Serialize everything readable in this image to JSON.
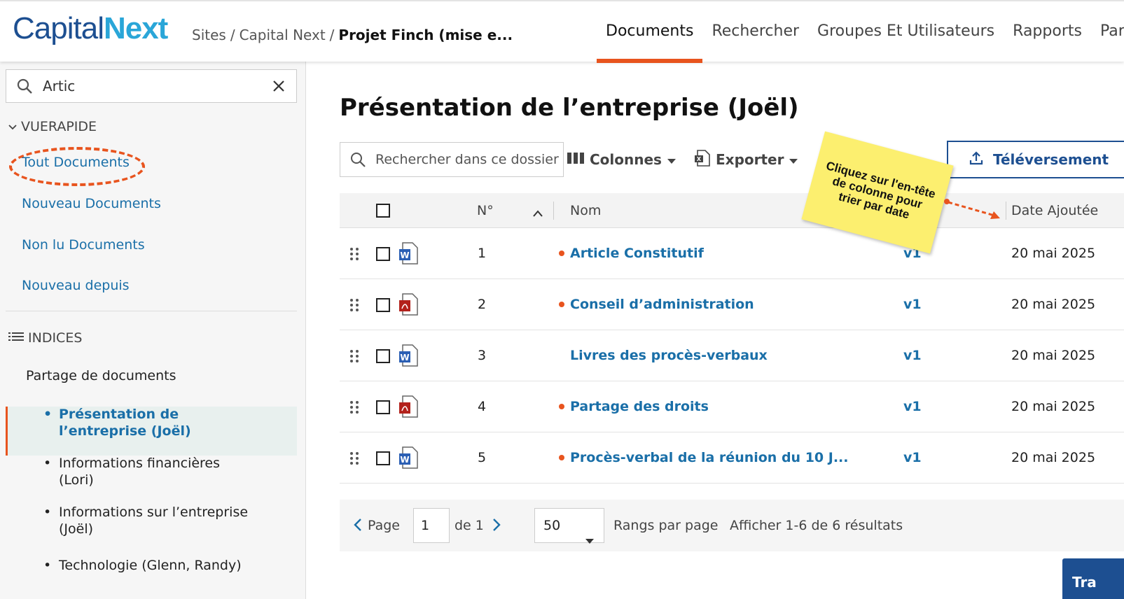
{
  "brand": {
    "part1": "Capital",
    "part2": "Next"
  },
  "breadcrumb": {
    "sites": "Sites",
    "sep": "/",
    "site": "Capital Next",
    "current": "Projet Finch (mise e..."
  },
  "topnav": [
    "Documents",
    "Rechercher",
    "Groupes Et Utilisateurs",
    "Rapports",
    "Para"
  ],
  "sidebar": {
    "search_value": "Artic",
    "quick_view_title": "VUERAPIDE",
    "quick_links": [
      "Tout Documents",
      "Nouveau Documents",
      "Non lu Documents",
      "Nouveau depuis"
    ],
    "indices_title": "INDICES",
    "index_root": "Partage de documents",
    "index_items": [
      {
        "line1": "Présentation de",
        "line2": "l’entreprise (Joël)"
      },
      {
        "line1": "Informations financières",
        "line2": "(Lori)"
      },
      {
        "line1": "Informations sur l’entreprise",
        "line2": "(Joël)"
      },
      {
        "line1": "Technologie (Glenn, Randy)",
        "line2": ""
      }
    ]
  },
  "main": {
    "title": "Présentation de l’entreprise (Joël)",
    "folder_search_placeholder": "Rechercher dans ce dossier",
    "columns_label": "Colonnes",
    "export_label": "Exporter",
    "upload_label": "Téléversement",
    "headers": {
      "num": "N°",
      "name": "Nom",
      "date": "Date Ajoutée"
    },
    "rows": [
      {
        "num": "1",
        "name": "Article Constitutif",
        "version": "v1",
        "date": "20 mai 2025",
        "type": "word",
        "new": true
      },
      {
        "num": "2",
        "name": "Conseil d’administration",
        "version": "v1",
        "date": "20 mai 2025",
        "type": "pdf",
        "new": true
      },
      {
        "num": "3",
        "name": "Livres des procès-verbaux",
        "version": "v1",
        "date": "20 mai 2025",
        "type": "word",
        "new": false
      },
      {
        "num": "4",
        "name": "Partage des droits",
        "version": "v1",
        "date": "20 mai 2025",
        "type": "pdf",
        "new": true
      },
      {
        "num": "5",
        "name": "Procès-verbal de la réunion du 10 J...",
        "version": "v1",
        "date": "20 mai 2025",
        "type": "word",
        "new": true
      }
    ],
    "pager": {
      "page_label": "Page",
      "page_value": "1",
      "of_label": "de 1",
      "per_page": "50",
      "per_page_label": "Rangs par page",
      "results": "Afficher 1-6 de 6 résultats"
    },
    "bottom_button": "Tra"
  },
  "annotation": {
    "note": "Cliquez sur l'en-tête de colonne pour trier par date",
    "accent": "#e8541e"
  },
  "colors": {
    "brand_dark": "#1d4f91",
    "brand_light": "#2aa6d8",
    "link": "#1a6fa8",
    "accent": "#e8541e"
  }
}
